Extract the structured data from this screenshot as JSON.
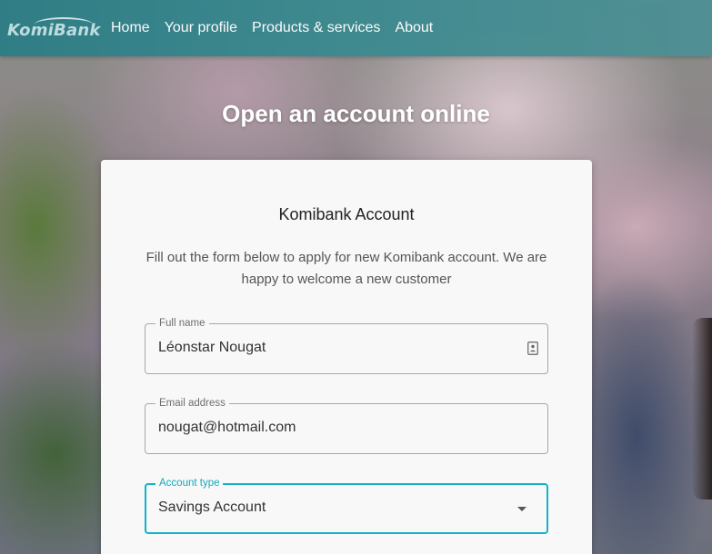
{
  "brand": {
    "logo_text": "KomiBank",
    "accent_color": "#13b3c9",
    "nav_color": "#2d7d86"
  },
  "nav": {
    "items": [
      {
        "label": "Home"
      },
      {
        "label": "Your profile"
      },
      {
        "label": "Products & services"
      },
      {
        "label": "About"
      }
    ]
  },
  "page": {
    "headline": "Open an account online"
  },
  "form": {
    "title": "Komibank Account",
    "description": "Fill out the form below to apply for new Komibank account. We are happy to welcome a new customer",
    "fields": {
      "full_name": {
        "label": "Full name",
        "value": "Léonstar Nougat",
        "icon": "contact-card-icon"
      },
      "email": {
        "label": "Email address",
        "value": "nougat@hotmail.com"
      },
      "account_type": {
        "label": "Account type",
        "selected": "Savings Account",
        "icon": "chevron-down-icon"
      }
    }
  }
}
